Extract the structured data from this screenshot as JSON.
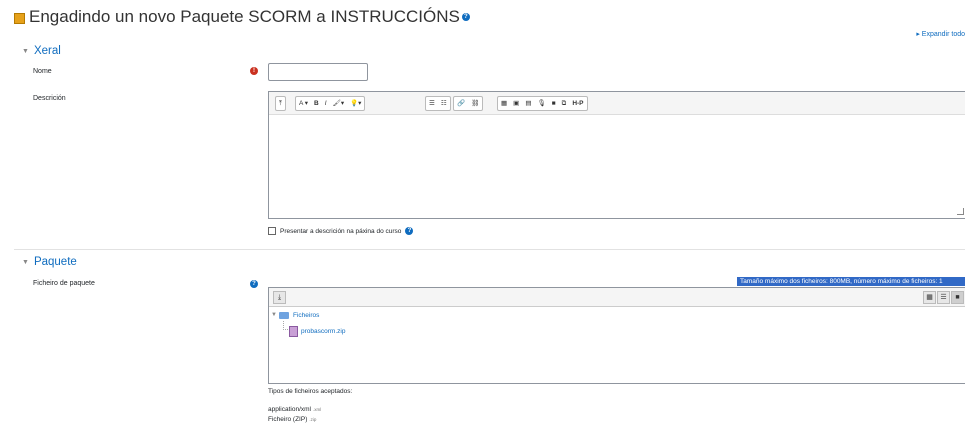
{
  "page": {
    "title": "Engadindo un novo Paquete SCORM a INSTRUCCIÓNS",
    "expand_all": "▸ Expandir todo"
  },
  "general": {
    "section_title": "Xeral",
    "name_label": "Nome",
    "name_value": "",
    "description_label": "Descrición",
    "toolbar": {
      "b1": "⤒",
      "font": "A ▾",
      "bold": "B",
      "italic": "I",
      "brush": "🖌▾",
      "lamp": "💡▾",
      "ul": "☰",
      "ol": "☷",
      "link": "🔗",
      "unlink": "⛓",
      "media1": "▦",
      "image": "▣",
      "file": "▤",
      "mic": "🎙",
      "video": "■",
      "copy": "⧉",
      "h5p": "H-P"
    },
    "show_description": "Presentar a descrición na páxina do curso"
  },
  "package": {
    "section_title": "Paquete",
    "file_label": "Ficheiro de paquete",
    "max_size": "Tamaño máximo dos ficheiros: 800MB, número máximo de ficheiros: 1",
    "folder_name": "Ficheiros",
    "file_name": "probascorm.zip",
    "accepted_title": "Tipos de ficheiros aceptados:",
    "accepted": [
      {
        "name": "application/xml",
        "ext": ".xml"
      },
      {
        "name": "Ficheiro (ZIP)",
        "ext": ".zip"
      }
    ]
  }
}
